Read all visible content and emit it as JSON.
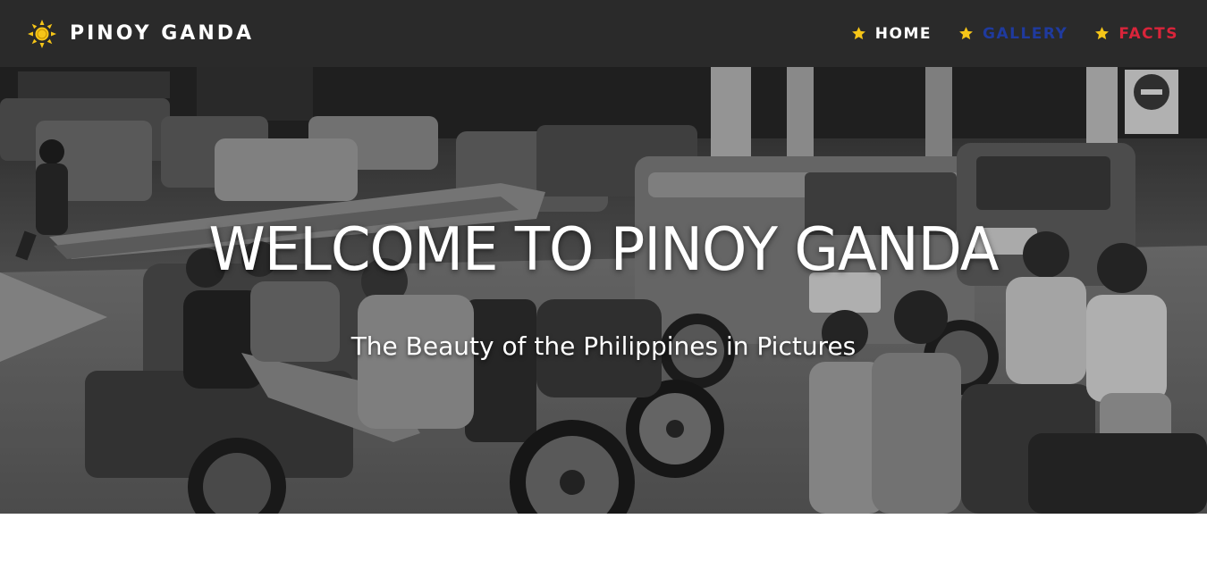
{
  "brand": {
    "icon": "sun-icon",
    "name": "PINOY GANDA"
  },
  "nav": {
    "items": [
      {
        "label": "HOME",
        "icon": "star-icon",
        "color": "#ffffff"
      },
      {
        "label": "GALLERY",
        "icon": "star-icon",
        "color": "#1f3a9e"
      },
      {
        "label": "FACTS",
        "icon": "star-icon",
        "color": "#d9243a"
      }
    ],
    "star_color": "#f5c518"
  },
  "hero": {
    "title": "WELCOME TO PINOY GANDA",
    "subtitle": "The Beauty of the Philippines in Pictures",
    "image": "black-and-white street scene with tricycles and jeepneys"
  },
  "colors": {
    "navbar_bg": "#2a2a2a",
    "sun": "#f5c518"
  }
}
